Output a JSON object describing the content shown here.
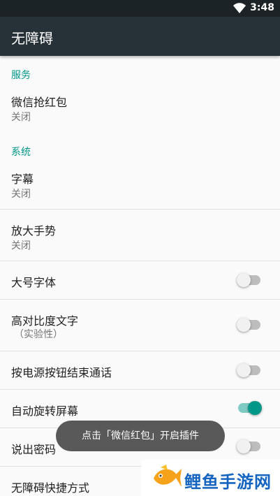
{
  "status_bar": {
    "time": "3:48",
    "wifi_icon": "wifi-icon"
  },
  "app_bar": {
    "title": "无障碍"
  },
  "sections": {
    "services": {
      "header": "服务"
    },
    "system": {
      "header": "系统"
    }
  },
  "items": {
    "wechat": {
      "title": "微信抢红包",
      "summary": "关闭"
    },
    "captions": {
      "title": "字幕",
      "summary": "关闭"
    },
    "magnification": {
      "title": "放大手势",
      "summary": "关闭"
    },
    "large_text": {
      "title": "大号字体",
      "on": false
    },
    "high_contrast": {
      "title": "高对比度文字",
      "summary": "（实验性）",
      "on": false
    },
    "power_ends_call": {
      "title": "按电源按钮结束通话",
      "on": false
    },
    "auto_rotate": {
      "title": "自动旋转屏幕",
      "on": true
    },
    "speak_passwords": {
      "title": "说出密码",
      "on": false
    },
    "shortcut": {
      "title": "无障碍快捷方式"
    }
  },
  "toast": {
    "text": "点击「微信红包」开启插件"
  },
  "watermark": {
    "text": "鲤鱼手游网",
    "logo_icon": "fish-logo-icon"
  },
  "colors": {
    "accent": "#009688",
    "toolbar": "#263238",
    "status_bar": "#1c2326"
  }
}
